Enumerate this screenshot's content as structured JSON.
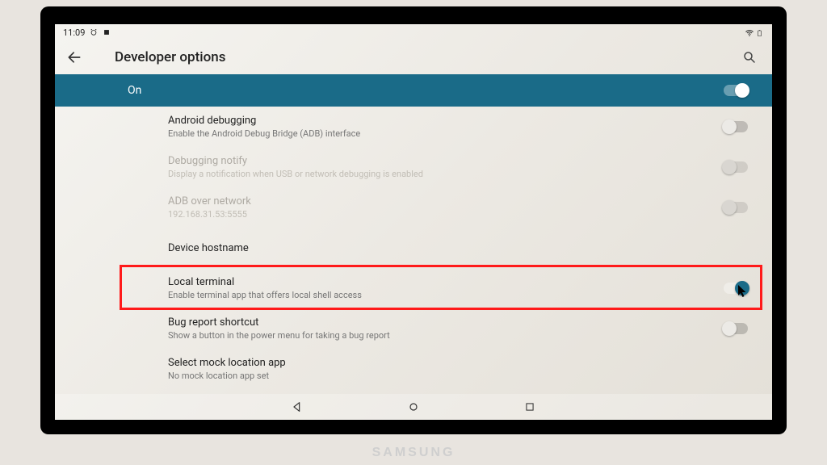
{
  "status": {
    "time": "11:09"
  },
  "header": {
    "title": "Developer options"
  },
  "master": {
    "label": "On",
    "enabled": true
  },
  "settings": [
    {
      "key": "android-debugging",
      "title": "Android debugging",
      "subtitle": "Enable the Android Debug Bridge (ADB) interface",
      "hasToggle": true,
      "toggleOn": false,
      "disabled": false
    },
    {
      "key": "debugging-notify",
      "title": "Debugging notify",
      "subtitle": "Display a notification when USB or network debugging is enabled",
      "hasToggle": true,
      "toggleOn": false,
      "disabled": true
    },
    {
      "key": "adb-over-network",
      "title": "ADB over network",
      "subtitle": "192.168.31.53:5555",
      "hasToggle": true,
      "toggleOn": false,
      "disabled": true
    },
    {
      "key": "device-hostname",
      "title": "Device hostname",
      "subtitle": "",
      "hasToggle": false,
      "disabled": false
    },
    {
      "key": "local-terminal",
      "title": "Local terminal",
      "subtitle": "Enable terminal app that offers local shell access",
      "hasToggle": true,
      "toggleOn": true,
      "disabled": false,
      "highlighted": true
    },
    {
      "key": "bug-report-shortcut",
      "title": "Bug report shortcut",
      "subtitle": "Show a button in the power menu for taking a bug report",
      "hasToggle": true,
      "toggleOn": false,
      "disabled": false
    },
    {
      "key": "select-mock-location",
      "title": "Select mock location app",
      "subtitle": "No mock location app set",
      "hasToggle": false,
      "disabled": false
    }
  ],
  "monitor_brand": "SAMSUNG"
}
